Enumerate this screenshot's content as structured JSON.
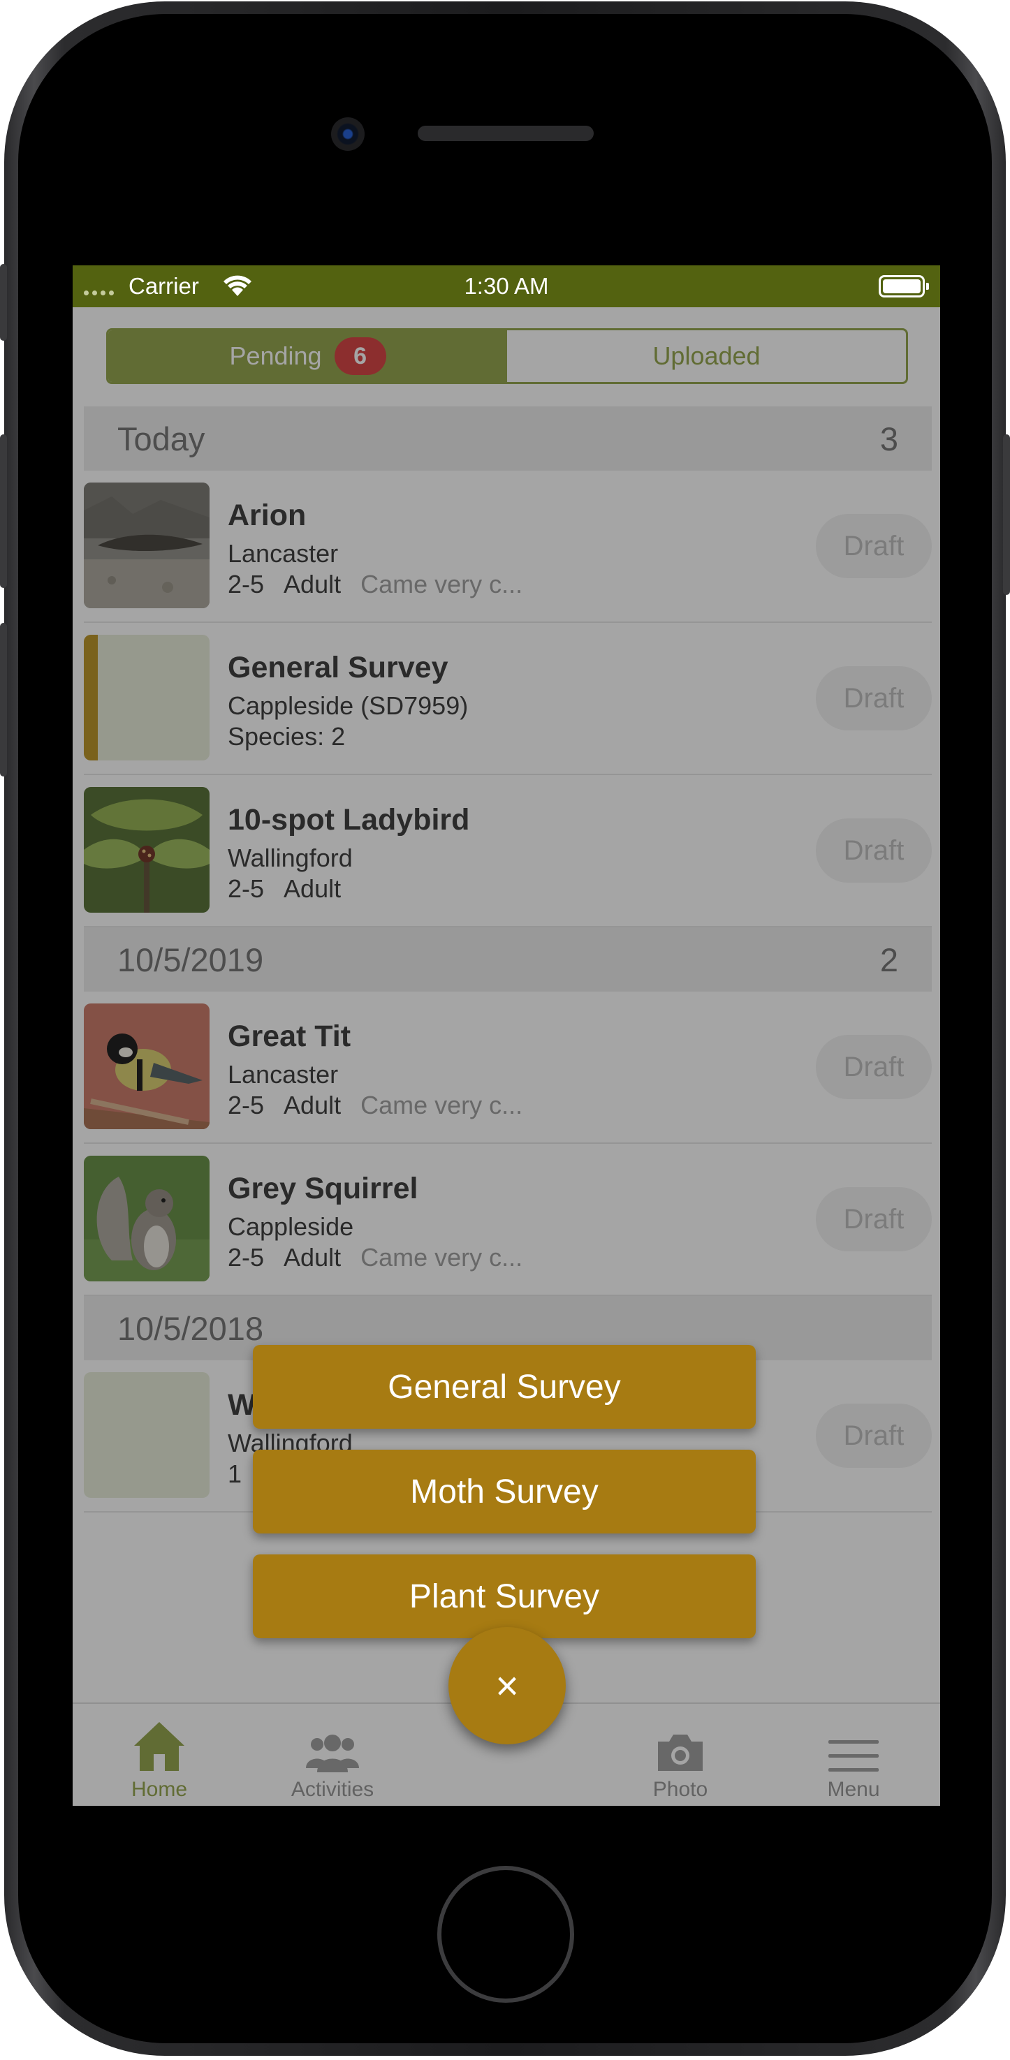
{
  "status_bar": {
    "carrier": "Carrier",
    "time": "1:30 AM"
  },
  "segment": {
    "pending_label": "Pending",
    "pending_count": "6",
    "uploaded_label": "Uploaded"
  },
  "sections": [
    {
      "header": "Today",
      "count": "3",
      "rows": [
        {
          "title": "Arion",
          "location": "Lancaster",
          "number": "2-5",
          "stage": "Adult",
          "comment": "Came very c...",
          "status": "Draft",
          "thumb": "slug-photo"
        },
        {
          "title": "General Survey",
          "location": "Cappleside (SD7959)",
          "species": "Species: 2",
          "status": "Draft",
          "thumb": "survey-placeholder"
        },
        {
          "title": "10-spot Ladybird",
          "location": "Wallingford",
          "number": "2-5",
          "stage": "Adult",
          "status": "Draft",
          "thumb": "ladybird-photo"
        }
      ]
    },
    {
      "header": "10/5/2019",
      "count": "2",
      "rows": [
        {
          "title": "Great Tit",
          "location": "Lancaster",
          "number": "2-5",
          "stage": "Adult",
          "comment": "Came very c...",
          "status": "Draft",
          "thumb": "great-tit-photo"
        },
        {
          "title": "Grey Squirrel",
          "location": "Cappleside",
          "number": "2-5",
          "stage": "Adult",
          "comment": "Came very c...",
          "status": "Draft",
          "thumb": "squirrel-photo"
        }
      ]
    },
    {
      "header": "10/5/2018",
      "rows": [
        {
          "title": "W",
          "location": "Wallingford",
          "number": "1",
          "status": "Draft",
          "thumb": "plain-placeholder"
        }
      ]
    }
  ],
  "survey_menu": {
    "general": "General Survey",
    "moth": "Moth Survey",
    "plant": "Plant Survey"
  },
  "tabs": {
    "home": "Home",
    "activities": "Activities",
    "photo": "Photo",
    "menu": "Menu"
  },
  "fab": {
    "icon": "close-icon",
    "symbol": "×"
  },
  "colors": {
    "brand_dark": "#536210",
    "brand": "#8ea043",
    "accent": "#a77b12",
    "badge": "#d63a3a"
  }
}
